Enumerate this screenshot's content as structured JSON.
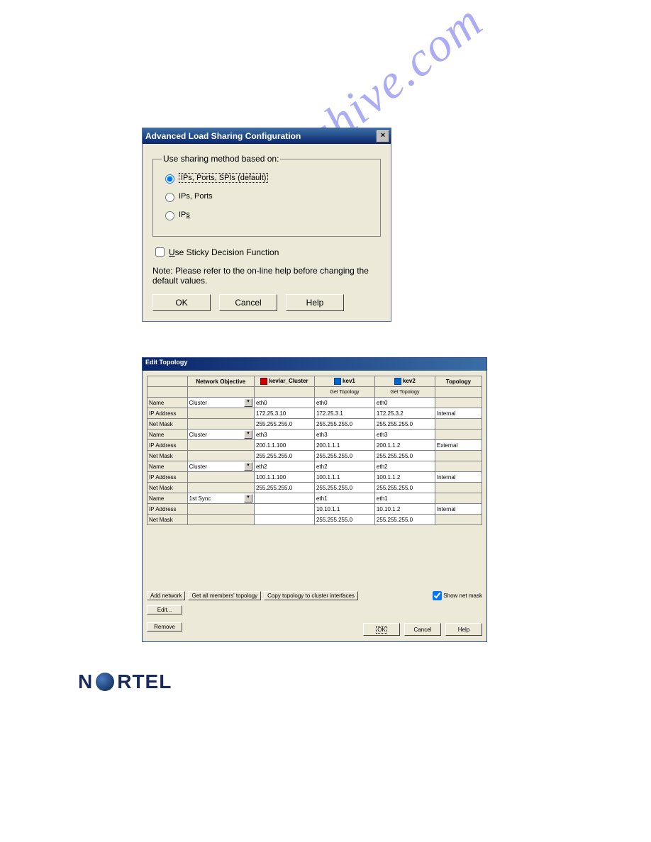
{
  "dialog1": {
    "title": "Advanced Load Sharing Configuration",
    "fieldset_legend": "Use sharing method based on:",
    "radio1": "IPs, Ports, SPIs (default)",
    "radio2": "IPs, Ports",
    "radio3": "IPs",
    "radio3_under": "s",
    "checkbox_under": "U",
    "checkbox_label": "se Sticky Decision Function",
    "note": "Note: Please refer to the on-line help before changing the default values.",
    "ok": "OK",
    "cancel": "Cancel",
    "help": "Help"
  },
  "dialog2": {
    "title": "Edit Topology",
    "headers": {
      "col1": "",
      "col2": "Network Objective",
      "col3": "kevlar_Cluster",
      "col4": "kev1",
      "col5": "kev2",
      "col6": "Topology"
    },
    "get_topology": "Get Topology",
    "rows": {
      "r1_label": "Name",
      "r1_dd": "Cluster",
      "r1_c": "eth0",
      "r1_k1": "eth0",
      "r1_k2": "eth0",
      "r1_t": "",
      "r2_label": "IP Address",
      "r2_c": "172.25.3.10",
      "r2_k1": "172.25.3.1",
      "r2_k2": "172.25.3.2",
      "r2_t": "Internal",
      "r3_label": "Net Mask",
      "r3_c": "255.255.255.0",
      "r3_k1": "255.255.255.0",
      "r3_k2": "255.255.255.0",
      "r3_t": "",
      "r4_label": "Name",
      "r4_dd": "Cluster",
      "r4_c": "eth3",
      "r4_k1": "eth3",
      "r4_k2": "eth3",
      "r4_t": "",
      "r5_label": "IP Address",
      "r5_c": "200.1.1.100",
      "r5_k1": "200.1.1.1",
      "r5_k2": "200.1.1.2",
      "r5_t": "External",
      "r6_label": "Net Mask",
      "r6_c": "255.255.255.0",
      "r6_k1": "255.255.255.0",
      "r6_k2": "255.255.255.0",
      "r6_t": "",
      "r7_label": "Name",
      "r7_dd": "Cluster",
      "r7_c": "eth2",
      "r7_k1": "eth2",
      "r7_k2": "eth2",
      "r7_t": "",
      "r8_label": "IP Address",
      "r8_c": "100.1.1.100",
      "r8_k1": "100.1.1.1",
      "r8_k2": "100.1.1.2",
      "r8_t": "Internal",
      "r9_label": "Net Mask",
      "r9_c": "255.255.255.0",
      "r9_k1": "255.255.255.0",
      "r9_k2": "255.255.255.0",
      "r9_t": "",
      "r10_label": "Name",
      "r10_dd": "1st Sync",
      "r10_c": "",
      "r10_k1": "eth1",
      "r10_k2": "eth1",
      "r10_t": "",
      "r11_label": "IP Address",
      "r11_c": "",
      "r11_k1": "10.10.1.1",
      "r11_k2": "10.10.1.2",
      "r11_t": "Internal",
      "r12_label": "Net Mask",
      "r12_c": "",
      "r12_k1": "255.255.255.0",
      "r12_k2": "255.255.255.0",
      "r12_t": ""
    },
    "add_network": "Add network",
    "get_all": "Get all members' topology",
    "copy_topo": "Copy topology to cluster interfaces",
    "show_netmask": "Show net mask",
    "edit": "Edit...",
    "remove": "Remove",
    "ok": "OK",
    "cancel": "Cancel",
    "help": "Help"
  },
  "watermark": "manualshive.com",
  "logo_text_n": "N",
  "logo_text_rtel": "RTEL"
}
